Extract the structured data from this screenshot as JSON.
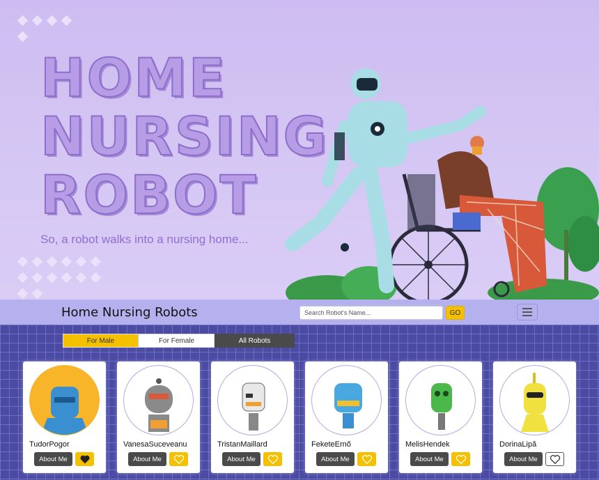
{
  "hero": {
    "title_lines": [
      "HOME",
      "NURSING",
      "ROBOT"
    ],
    "subtitle": "So, a robot walks into a nursing home..."
  },
  "navbar": {
    "brand": "Home Nursing Robots",
    "search_placeholder": "Search Robot's Name...",
    "go_label": "GO"
  },
  "filters": {
    "male": "For Male",
    "female": "For Female",
    "all": "All Robots"
  },
  "robots": [
    {
      "name": "TudorPogor",
      "about": "About Me",
      "favorite": "dark",
      "avatar_bg": "yellow"
    },
    {
      "name": "VanesaSuceveanu",
      "about": "About Me",
      "favorite": "yellow",
      "avatar_bg": "white"
    },
    {
      "name": "TristanMaillard",
      "about": "About Me",
      "favorite": "yellow",
      "avatar_bg": "white"
    },
    {
      "name": "FeketeErnő",
      "about": "About Me",
      "favorite": "yellow",
      "avatar_bg": "white"
    },
    {
      "name": "MelisHendek",
      "about": "About Me",
      "favorite": "yellow",
      "avatar_bg": "white"
    },
    {
      "name": "DorinaLipă",
      "about": "About Me",
      "favorite": "outline",
      "avatar_bg": "white"
    }
  ],
  "colors": {
    "accent": "#f5c000",
    "navbar": "#b4b1ee",
    "grid_bg": "#4b4ba3",
    "hero_text": "#b79ce6"
  }
}
